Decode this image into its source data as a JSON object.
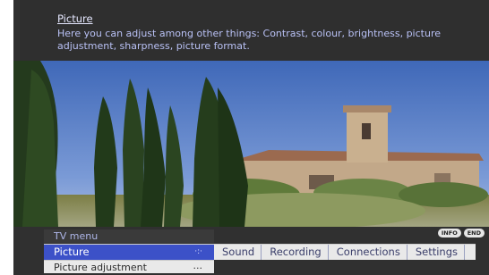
{
  "info": {
    "title": "Picture",
    "text": "Here you can adjust among other things: Contrast, colour, brightness, picture adjustment, sharpness, picture format."
  },
  "badges": {
    "info": "INFO",
    "end": "END"
  },
  "menu": {
    "caption": "TV menu",
    "tabs": [
      {
        "label": "Picture",
        "active": true
      },
      {
        "label": "Sound",
        "active": false
      },
      {
        "label": "Recording",
        "active": false
      },
      {
        "label": "Connections",
        "active": false
      },
      {
        "label": "Settings",
        "active": false
      }
    ],
    "nav_glyph": "·:·",
    "submenu": {
      "label": "Picture adjustment",
      "more": "..."
    }
  },
  "colors": {
    "accent": "#3c51c8",
    "panel": "#2f2f2f",
    "bar": "#e9e9e9"
  },
  "scene": {
    "icons": [
      "cypress-trees",
      "stone-church",
      "olive-hedge"
    ]
  }
}
